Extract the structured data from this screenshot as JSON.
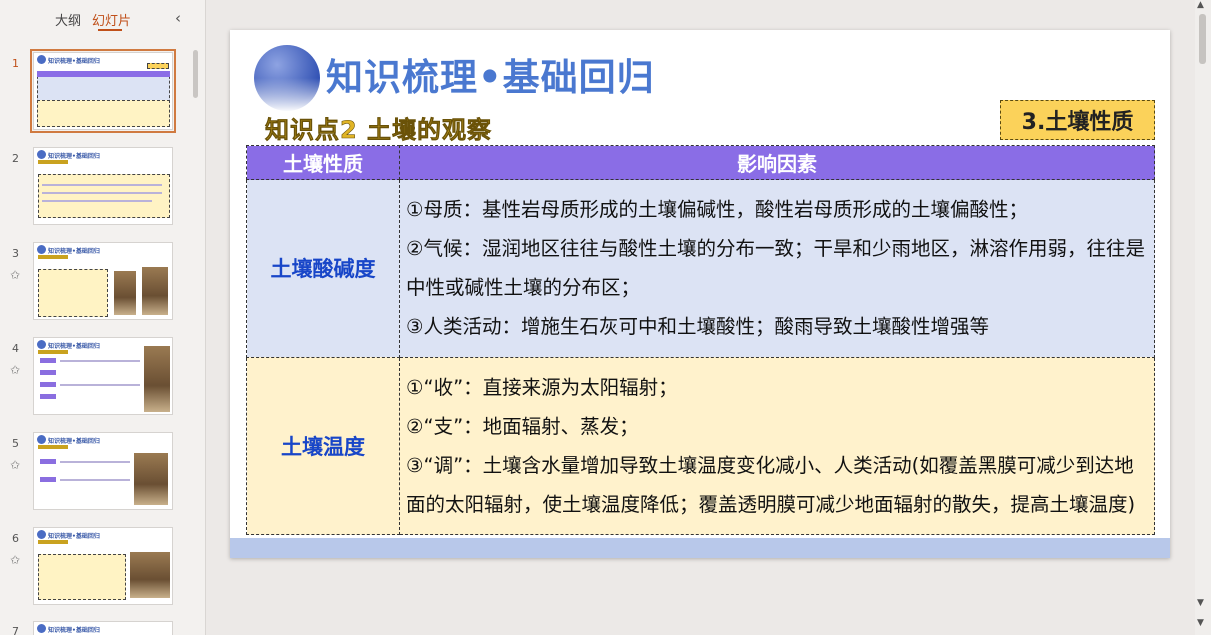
{
  "panel": {
    "tab_outline": "大纲",
    "tab_slides": "幻灯片",
    "collapse_icon": "‹"
  },
  "thumbnails": [
    {
      "num": "1",
      "title": "知识梳理•基础回归"
    },
    {
      "num": "2",
      "title": "知识梳理•基础回归"
    },
    {
      "num": "3",
      "title": "知识梳理•基础回归"
    },
    {
      "num": "4",
      "title": "知识梳理•基础回归"
    },
    {
      "num": "5",
      "title": "知识梳理•基础回归"
    },
    {
      "num": "6",
      "title": "知识梳理•基础回归"
    },
    {
      "num": "7",
      "title": "知识梳理•基础回归"
    }
  ],
  "icons": {
    "star": "✩",
    "scroll_up": "▲",
    "scroll_down": "▼"
  },
  "slide": {
    "title": "知识梳理•基础回归",
    "subtitle": "知识点2  土壤的观察",
    "badge": "3.土壤性质",
    "table": {
      "headers": [
        "土壤性质",
        "影响因素"
      ],
      "rows": [
        {
          "property": "土壤酸碱度",
          "factors": [
            "①母质：基性岩母质形成的土壤偏碱性，酸性岩母质形成的土壤偏酸性；",
            "②气候：湿润地区往往与酸性土壤的分布一致；干旱和少雨地区，淋溶作用弱，往往是中性或碱性土壤的分布区；",
            "③人类活动：增施生石灰可中和土壤酸性；酸雨导致土壤酸性增强等"
          ]
        },
        {
          "property": "土壤温度",
          "factors": [
            "①“收”：直接来源为太阳辐射；",
            "②“支”：地面辐射、蒸发；",
            "③“调”：土壤含水量增加导致土壤温度变化减小、人类活动(如覆盖黑膜可减少到达地面的太阳辐射，使土壤温度降低；覆盖透明膜可减少地面辐射的散失，提高土壤温度)"
          ]
        }
      ]
    }
  },
  "colors": {
    "accent": "#c0501a",
    "header_purple": "#8a6de6",
    "row_blue": "#dce3f4",
    "row_yellow": "#fff2cc",
    "property_text": "#1846c8",
    "badge_bg": "#fbd25a",
    "title_blue": "#4a78d0"
  }
}
